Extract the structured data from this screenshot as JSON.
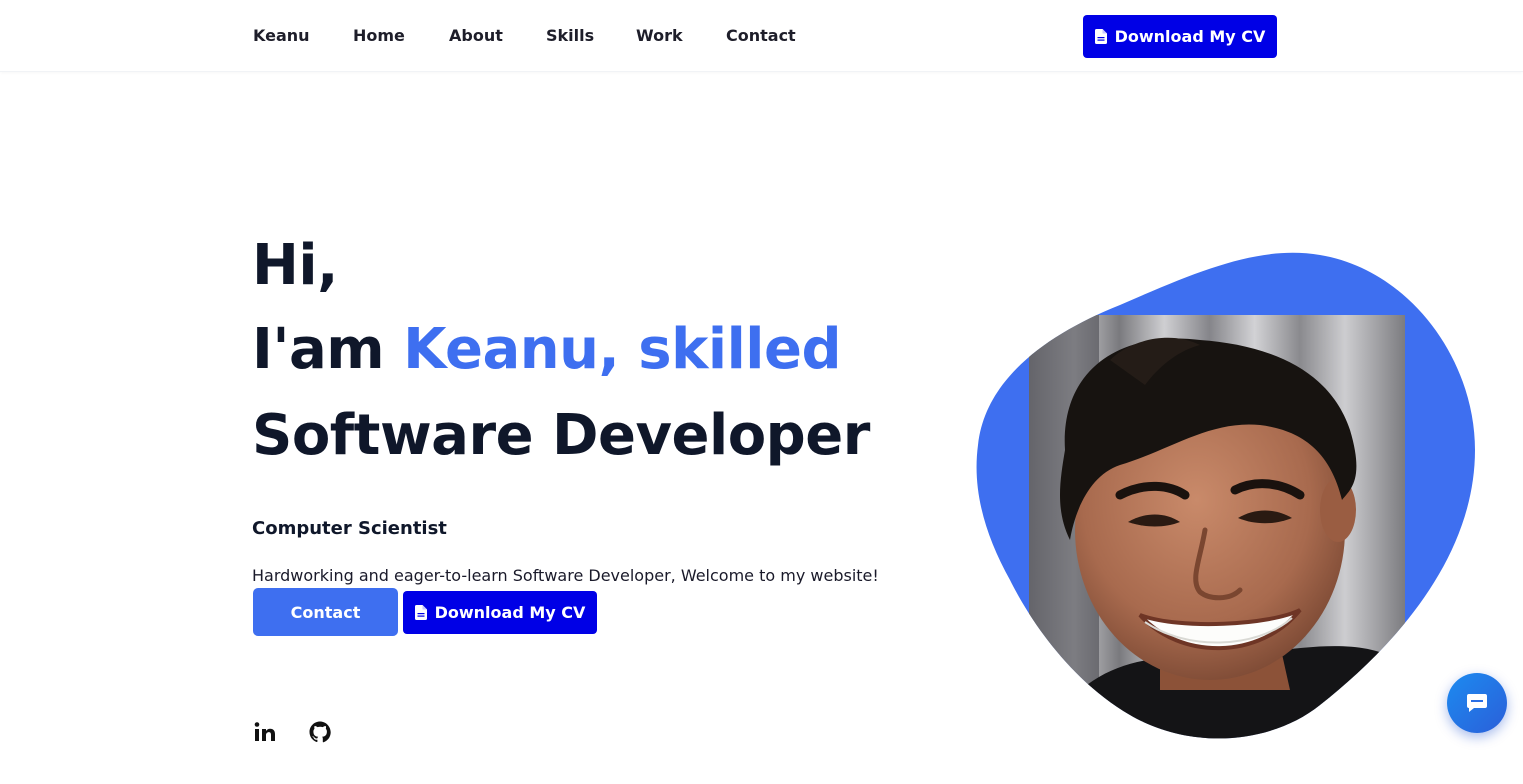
{
  "nav": {
    "brand": "Keanu",
    "links": [
      "Home",
      "About",
      "Skills",
      "Work",
      "Contact"
    ],
    "cta_label": "Download My CV"
  },
  "hero": {
    "greeting": "Hi,",
    "intro_prefix": "I'am ",
    "intro_highlight": "Keanu, skilled",
    "role": "Software Developer",
    "subtitle": "Computer Scientist",
    "tagline": "Hardworking and eager-to-learn Software Developer, Welcome to my website!",
    "contact_label": "Contact",
    "cv_label": "Download My CV"
  },
  "social": [
    "linkedin-icon",
    "github-icon"
  ],
  "colors": {
    "accent": "#3e6ff0",
    "cta": "#0000e6",
    "text": "#0f172a"
  }
}
